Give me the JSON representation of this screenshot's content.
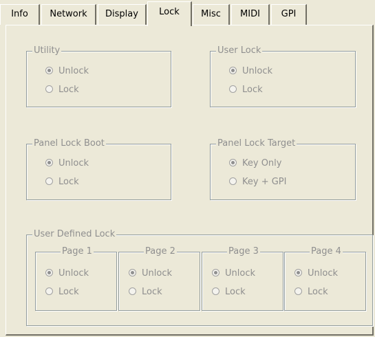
{
  "tabs": [
    {
      "label": "Info",
      "active": false
    },
    {
      "label": "Network",
      "active": false
    },
    {
      "label": "Display",
      "active": false
    },
    {
      "label": "Lock",
      "active": true
    },
    {
      "label": "Misc",
      "active": false
    },
    {
      "label": "MIDI",
      "active": false
    },
    {
      "label": "GPI",
      "active": false
    }
  ],
  "utility": {
    "legend": "Utility",
    "options": [
      "Unlock",
      "Lock"
    ],
    "selected": "Unlock"
  },
  "user_lock": {
    "legend": "User Lock",
    "options": [
      "Unlock",
      "Lock"
    ],
    "selected": "Unlock"
  },
  "panel_lock_boot": {
    "legend": "Panel Lock Boot",
    "options": [
      "Unlock",
      "Lock"
    ],
    "selected": "Unlock"
  },
  "panel_lock_target": {
    "legend": "Panel Lock Target",
    "options": [
      "Key Only",
      "Key + GPI"
    ],
    "selected": "Key Only"
  },
  "user_defined_lock": {
    "legend": "User Defined Lock",
    "pages": [
      {
        "legend": "Page 1",
        "options": [
          "Unlock",
          "Lock"
        ],
        "selected": "Unlock"
      },
      {
        "legend": "Page 2",
        "options": [
          "Unlock",
          "Lock"
        ],
        "selected": "Unlock"
      },
      {
        "legend": "Page 3",
        "options": [
          "Unlock",
          "Lock"
        ],
        "selected": "Unlock"
      },
      {
        "legend": "Page 4",
        "options": [
          "Unlock",
          "Lock"
        ],
        "selected": "Unlock"
      }
    ]
  },
  "colors": {
    "face": "#ece9d8",
    "disabled_text": "#8f8f8f",
    "group_border": "#919b9c"
  }
}
